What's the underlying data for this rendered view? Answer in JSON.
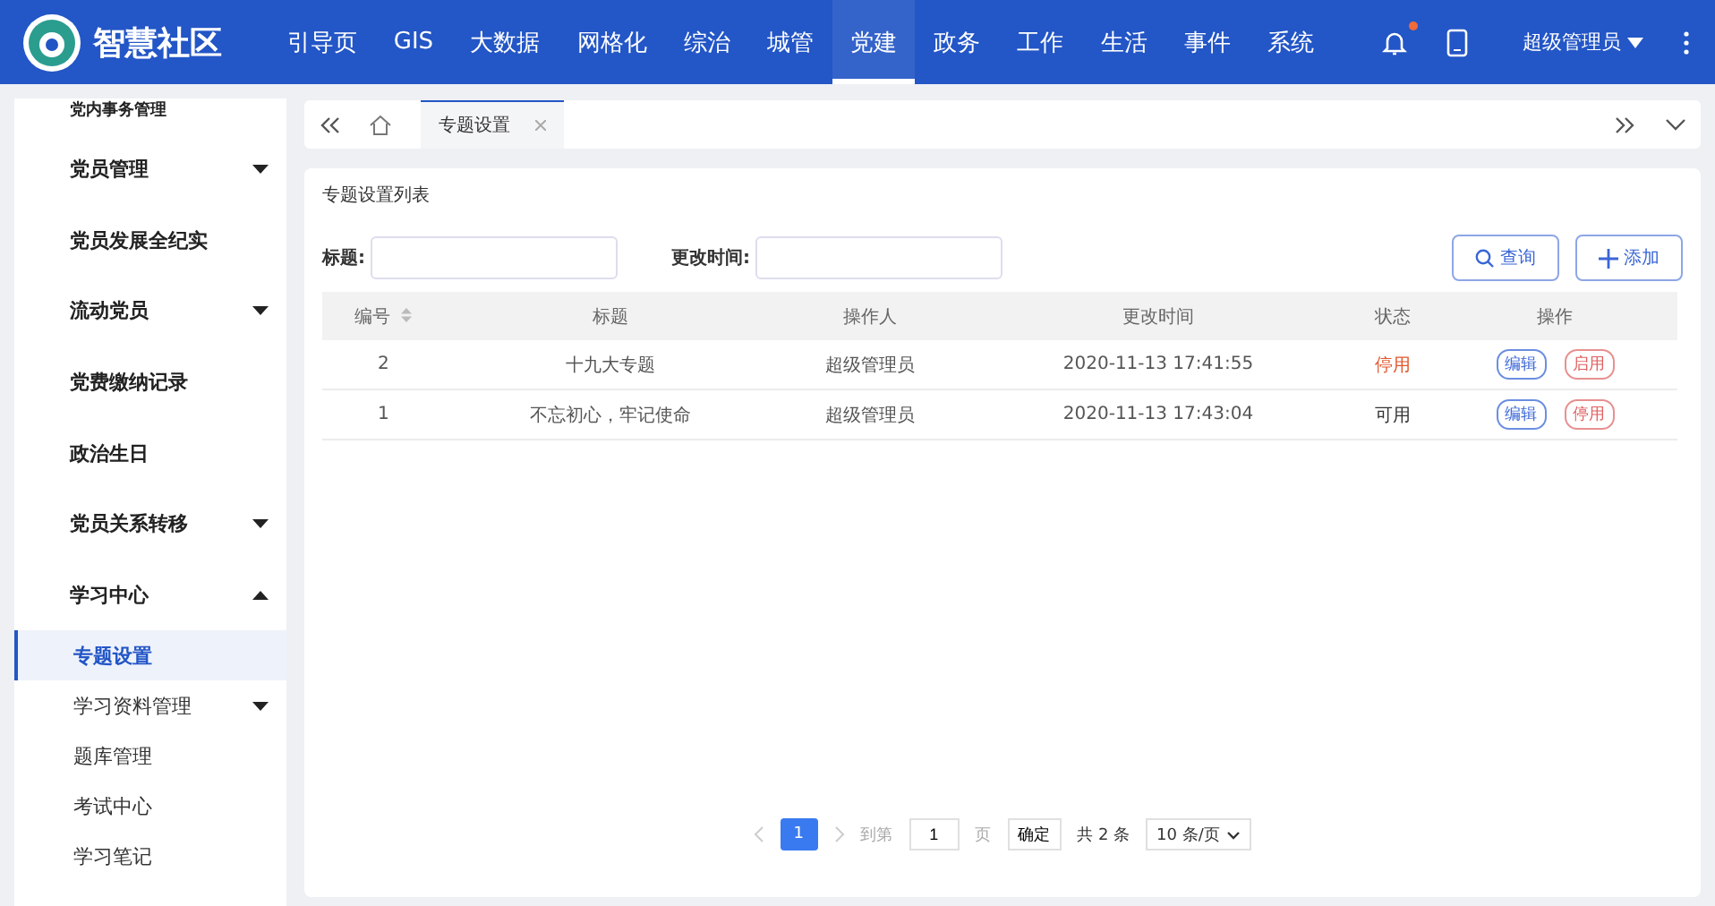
{
  "header": {
    "title": "智慧社区",
    "nav": [
      {
        "label": "引导页",
        "selected": false
      },
      {
        "label": "GIS",
        "selected": false
      },
      {
        "label": "大数据",
        "selected": false
      },
      {
        "label": "网格化",
        "selected": false
      },
      {
        "label": "综治",
        "selected": false
      },
      {
        "label": "城管",
        "selected": false
      },
      {
        "label": "党建",
        "selected": true
      },
      {
        "label": "政务",
        "selected": false
      },
      {
        "label": "工作",
        "selected": false
      },
      {
        "label": "生活",
        "selected": false
      },
      {
        "label": "事件",
        "selected": false
      },
      {
        "label": "系统",
        "selected": false
      }
    ],
    "has_notification": true,
    "user": "超级管理员"
  },
  "sidebar": {
    "items": [
      {
        "label": "党内事务管理",
        "kind": "link"
      },
      {
        "label": "党员管理",
        "kind": "group",
        "expanded": false
      },
      {
        "label": "党员发展全纪实",
        "kind": "link"
      },
      {
        "label": "流动党员",
        "kind": "group",
        "expanded": false
      },
      {
        "label": "党费缴纳记录",
        "kind": "link"
      },
      {
        "label": "政治生日",
        "kind": "link"
      },
      {
        "label": "党员关系转移",
        "kind": "group",
        "expanded": false
      },
      {
        "label": "学习中心",
        "kind": "group",
        "expanded": true,
        "children": [
          {
            "label": "专题设置",
            "kind": "link",
            "selected": true
          },
          {
            "label": "学习资料管理",
            "kind": "group",
            "expanded": false,
            "selected": false
          },
          {
            "label": "题库管理",
            "kind": "link",
            "selected": false
          },
          {
            "label": "考试中心",
            "kind": "link",
            "selected": false
          },
          {
            "label": "学习笔记",
            "kind": "link",
            "selected": false
          }
        ]
      }
    ]
  },
  "tabs": [
    {
      "label": "专题设置",
      "selected": true
    }
  ],
  "panel": {
    "title": "专题设置列表",
    "filters": [
      {
        "label": "标题:"
      },
      {
        "label": "更改时间:"
      }
    ],
    "buttons": [
      {
        "label": "查询",
        "kind": "search"
      },
      {
        "label": "添加",
        "kind": "add"
      }
    ],
    "table": {
      "columns": [
        {
          "label": "编号",
          "sortable": true
        },
        {
          "label": "标题",
          "sortable": false
        },
        {
          "label": "操作人",
          "sortable": false
        },
        {
          "label": "更改时间",
          "sortable": false
        },
        {
          "label": "状态",
          "sortable": false
        },
        {
          "label": "操作",
          "sortable": false
        }
      ],
      "rows": [
        {
          "id": "2",
          "title": "十九大专题",
          "operator": "超级管理员",
          "time": "2020-11-13 17:41:55",
          "status": "停用",
          "enabled": false,
          "actions": [
            "编辑",
            "启用"
          ]
        },
        {
          "id": "1",
          "title": "不忘初心，牢记使命",
          "operator": "超级管理员",
          "time": "2020-11-13 17:43:04",
          "status": "可用",
          "enabled": true,
          "actions": [
            "编辑",
            "停用"
          ]
        }
      ]
    },
    "pagination": {
      "pages": [
        {
          "label": "1",
          "selected": true
        }
      ],
      "goto_label": "到第",
      "goto_value": "1",
      "page_unit": "页",
      "confirm": "确定",
      "total": "共 2 条",
      "page_size": "10 条/页"
    }
  }
}
